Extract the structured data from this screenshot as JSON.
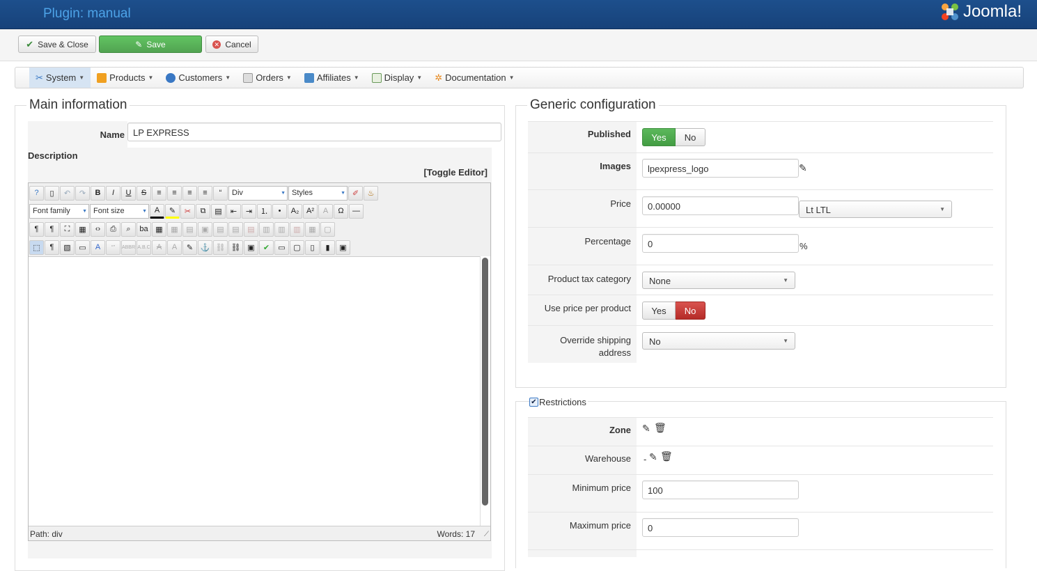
{
  "header": {
    "title": "Plugin: manual",
    "brand": "Joomla!"
  },
  "toolbar": {
    "save_close": "Save & Close",
    "save": "Save",
    "cancel": "Cancel"
  },
  "menu": [
    {
      "label": "System",
      "icon": "tools-icon"
    },
    {
      "label": "Products",
      "icon": "products-icon"
    },
    {
      "label": "Customers",
      "icon": "customers-icon"
    },
    {
      "label": "Orders",
      "icon": "orders-icon"
    },
    {
      "label": "Affiliates",
      "icon": "affiliates-icon"
    },
    {
      "label": "Display",
      "icon": "display-icon"
    },
    {
      "label": "Documentation",
      "icon": "documentation-icon"
    }
  ],
  "main": {
    "legend": "Main information",
    "name_label": "Name",
    "name_value": "LP EXPRESS",
    "description_label": "Description",
    "toggle_editor": "[Toggle Editor]",
    "editor": {
      "format_select": "Div",
      "styles_select": "Styles",
      "font_family": "Font family",
      "font_size": "Font size",
      "path": "Path:  div",
      "words": "Words: 17"
    }
  },
  "generic": {
    "legend": "Generic configuration",
    "published_label": "Published",
    "published_yes": "Yes",
    "published_no": "No",
    "images_label": "Images",
    "images_value": "lpexpress_logo",
    "price_label": "Price",
    "price_value": "0.00000",
    "currency": "Lt LTL",
    "percentage_label": "Percentage",
    "percentage_value": "0",
    "percent_sign": "%",
    "tax_label": "Product tax category",
    "tax_value": "None",
    "ppp_label": "Use price per product",
    "ppp_yes": "Yes",
    "ppp_no": "No",
    "override_label": "Override shipping address",
    "override_value": "No"
  },
  "restrictions": {
    "legend": "Restrictions",
    "zone_label": "Zone",
    "warehouse_label": "Warehouse",
    "warehouse_value": "-",
    "min_label": "Minimum price",
    "min_value": "100",
    "max_label": "Maximum price",
    "max_value": "0"
  },
  "colors": {
    "header_bg": "#1d4f8c",
    "accent_green": "#5cb85c",
    "accent_red": "#c9302c"
  }
}
